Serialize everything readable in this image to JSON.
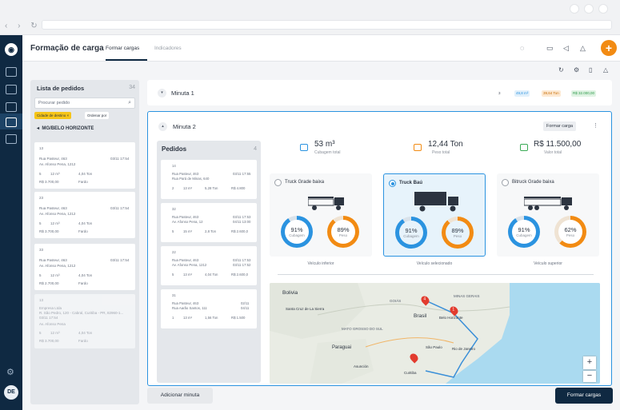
{
  "header": {
    "title": "Formação de carga",
    "tabs": [
      "Formar cargas",
      "Indicadores"
    ]
  },
  "fab": "+",
  "lista": {
    "title": "Lista de pedidos",
    "count": "34",
    "search_placeholder": "Procurar pedido",
    "filter_chip": "Cidade de destino ×",
    "sort": "Ordenar por",
    "group": "MG/BELO HORIZONTE",
    "cards": [
      {
        "id": "13",
        "addr1": "Rua Pasteur, 463",
        "addr2": "Av. Afonso Pena, 1212",
        "d1": "03/11 17:54",
        "d2": "03/11 17:54",
        "qty": "5",
        "vol": "12 m³",
        "wt": "4,04 Ton",
        "val": "R$ 3.700,00",
        "unit": "Fardo"
      },
      {
        "id": "23",
        "addr1": "Rua Pasteur, 463",
        "addr2": "Av. Afonso Pena, 1212",
        "d1": "03/11 17:54",
        "d2": "03/11 17:54",
        "qty": "5",
        "vol": "12 m³",
        "wt": "4,04 Ton",
        "val": "R$ 3.700,00",
        "unit": "Fardo"
      },
      {
        "id": "33",
        "addr1": "Rua Pasteur, 463",
        "addr2": "Av. Afonso Pena, 1212",
        "d1": "03/11 17:54",
        "d2": "03/11 17:54",
        "qty": "5",
        "vol": "12 m³",
        "wt": "4,04 Ton",
        "val": "R$ 2.700,00",
        "unit": "Fardo"
      },
      {
        "id": "13",
        "addr1": "Empresa Ltda",
        "addr2": "R. São Pedro, 120 - Cabral, Curitiba - PR, 82960-1...",
        "d1": "03/11 17:54",
        "d2": "",
        "qty": "5",
        "vol": "12 m³",
        "wt": "4,04 Ton",
        "val": "R$ 3.700,00",
        "unit": "Fardo",
        "sub": "Av. Afonso Pena"
      }
    ]
  },
  "minuta1": {
    "title": "Minuta 1",
    "badges": [
      "3",
      "49,8 m³",
      "39,64 Ton",
      "R$ 32.000,00"
    ]
  },
  "minuta2": {
    "title": "Minuta 2",
    "action": "Formar carga",
    "stats": [
      {
        "value": "53 m³",
        "label": "Cubagem total"
      },
      {
        "value": "12,44 Ton",
        "label": "Peso total"
      },
      {
        "value": "R$ 11.500,00",
        "label": "Valor total"
      }
    ],
    "trucks": [
      {
        "name": "Truck Grade baixa",
        "cub": "91%",
        "cub_label": "Cubagem",
        "peso": "89%",
        "peso_label": "Peso",
        "caption": "Veículo inferior",
        "cub_frac": 0.91,
        "peso_frac": 0.89
      },
      {
        "name": "Truck Baú",
        "cub": "91%",
        "cub_label": "Cubagem",
        "peso": "89%",
        "peso_label": "Peso",
        "caption": "Veículo selecionado",
        "cub_frac": 0.91,
        "peso_frac": 0.89
      },
      {
        "name": "Bitruck Grade baixa",
        "cub": "91%",
        "cub_label": "Cubagem",
        "peso": "62%",
        "peso_label": "Peso",
        "caption": "Veículo superior",
        "cub_frac": 0.91,
        "peso_frac": 0.62
      }
    ],
    "map_labels": {
      "bolivia": "Bolivia",
      "santa_cruz": "Santa Cruz de La Sierra",
      "brasil": "Brasil",
      "paraguai": "Paraguai",
      "asuncion": "Asunción",
      "belo": "Belo Horizonte",
      "sao_paulo": "São Paulo",
      "rio": "Rio de Janeiro",
      "curitiba": "Curitiba",
      "minas": "MINAS GERAIS",
      "goias": "GOIÁS",
      "mato": "MATO GROSSO DO SUL",
      "pin1": "4",
      "pin2": "1"
    }
  },
  "pedidos": {
    "title": "Pedidos",
    "count": "4",
    "cards": [
      {
        "id": "14",
        "addr1": "Rua Pasteur, 463",
        "addr2": "Rua Pará de Minas, 640",
        "d1": "03/11 17:55",
        "qty": "2",
        "vol": "13 m³",
        "wt": "5,28 Ton",
        "val": "R$ 4.800"
      },
      {
        "id": "32",
        "addr1": "Rua Pasteur, 463",
        "addr2": "Av. Afonso Pena, 12",
        "d1": "03/11 17:53",
        "d2": "04/11 13:00",
        "qty": "5",
        "vol": "15 m³",
        "wt": "2,8 Ton",
        "val": "R$ 2.600,0"
      },
      {
        "id": "22",
        "addr1": "Rua Pasteur, 463",
        "addr2": "Av. Afonso Pena, 1212",
        "d1": "03/11 17:53",
        "d2": "03/11 17:52",
        "qty": "5",
        "vol": "13 m³",
        "wt": "4,04 Ton",
        "val": "R$ 2.600,0"
      },
      {
        "id": "31",
        "addr1": "Rua Pasteur, 463",
        "addr2": "Rua Aarão Santos, 111",
        "d1": "02/11",
        "d2": "04/11",
        "qty": "1",
        "vol": "13 m³",
        "wt": "1,56 Ton",
        "val": "R$ 1.500"
      }
    ]
  },
  "footer": {
    "add": "Adicionar minuta",
    "submit": "Formar cargas"
  },
  "colors": {
    "navy": "#0f2942",
    "blue": "#2b93e0",
    "orange": "#f28b13",
    "yellow": "#f6c519"
  }
}
